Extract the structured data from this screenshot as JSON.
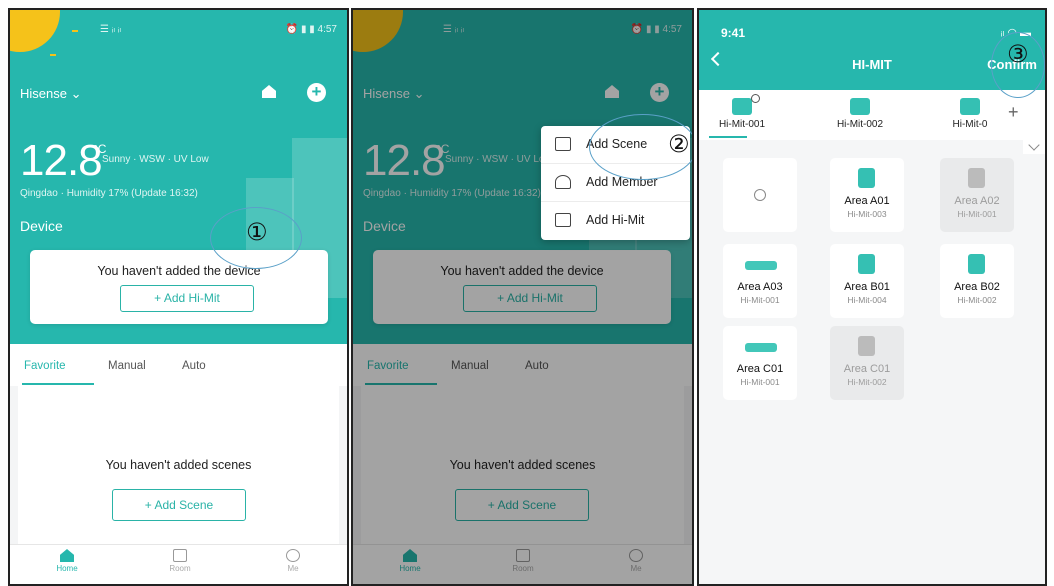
{
  "home": {
    "status_left": "☰ ᵢₗ ᵢₗ",
    "status_right": "⏰ ▮ ▮ 4:57",
    "home_name": "Hisense ⌄",
    "temperature": "12.8",
    "temp_unit": "°C",
    "weather": "Sunny · WSW · UV Low",
    "location": "Qingdao · Humidity 17% (Update 16:32)",
    "device_label": "Device",
    "empty_device_text": "You haven't added the device",
    "add_himit_label": "+ Add Hi-Mit",
    "tabs": [
      "Favorite",
      "Manual",
      "Auto"
    ],
    "empty_scene_text": "You haven't added scenes",
    "add_scene_label": "+ Add Scene",
    "nav": [
      "Home",
      "Room",
      "Me"
    ]
  },
  "menu": {
    "items": [
      "Add Scene",
      "Add Member",
      "Add Hi-Mit"
    ]
  },
  "callouts": {
    "one": "①",
    "two": "②",
    "three": "③"
  },
  "himit_screen": {
    "time": "9:41",
    "status_right": "ᵢₗ ◠ ▬",
    "title": "HI-MIT",
    "confirm": "Confirm",
    "hubs": [
      "Hi-Mit-001",
      "Hi-Mit-002",
      "Hi-Mit-0"
    ],
    "add_hub": "+",
    "cards": [
      {
        "name": "",
        "sub": "",
        "state": "search"
      },
      {
        "name": "Area A01",
        "sub": "Hi-Mit-003",
        "state": "on"
      },
      {
        "name": "Area A02",
        "sub": "Hi-Mit-001",
        "state": "off"
      },
      {
        "name": "Area A03",
        "sub": "Hi-Mit-001",
        "state": "on-wide"
      },
      {
        "name": "Area B01",
        "sub": "Hi-Mit-004",
        "state": "on"
      },
      {
        "name": "Area B02",
        "sub": "Hi-Mit-002",
        "state": "on"
      },
      {
        "name": "Area C01",
        "sub": "Hi-Mit-001",
        "state": "on-wide"
      },
      {
        "name": "Area C01",
        "sub": "Hi-Mit-002",
        "state": "off"
      }
    ]
  },
  "colors": {
    "teal": "#26b7ad",
    "card_icon": "#35c0b3",
    "sun": "#f5c21a"
  }
}
